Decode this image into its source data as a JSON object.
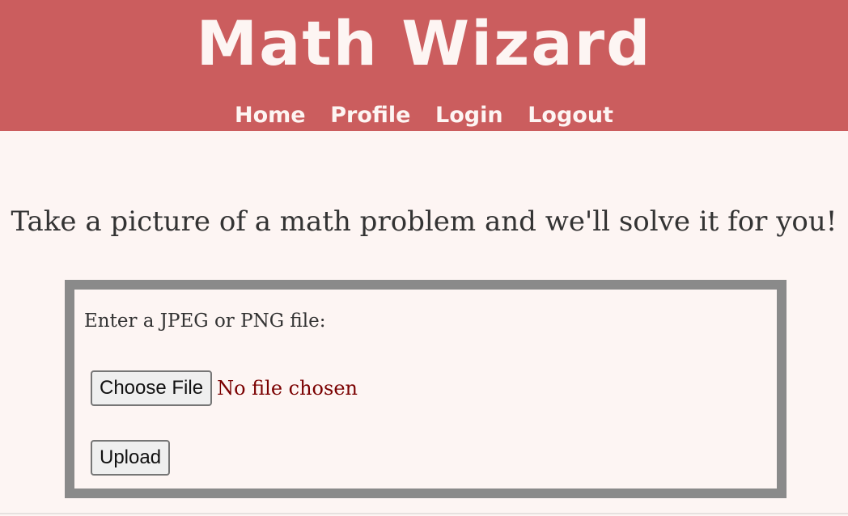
{
  "header": {
    "title": "Math Wizard",
    "nav": [
      "Home",
      "Profile",
      "Login",
      "Logout"
    ]
  },
  "main": {
    "tagline": "Take a picture of a math problem and we'll solve it for you!",
    "upload": {
      "label": "Enter a JPEG or PNG file:",
      "choose_button": "Choose File",
      "file_status": "No file chosen",
      "upload_button": "Upload"
    }
  },
  "colors": {
    "header_bg": "#cb5d5e",
    "page_bg": "#fdf5f3",
    "box_border": "#8a8a8a",
    "status_text": "#7a0000"
  }
}
